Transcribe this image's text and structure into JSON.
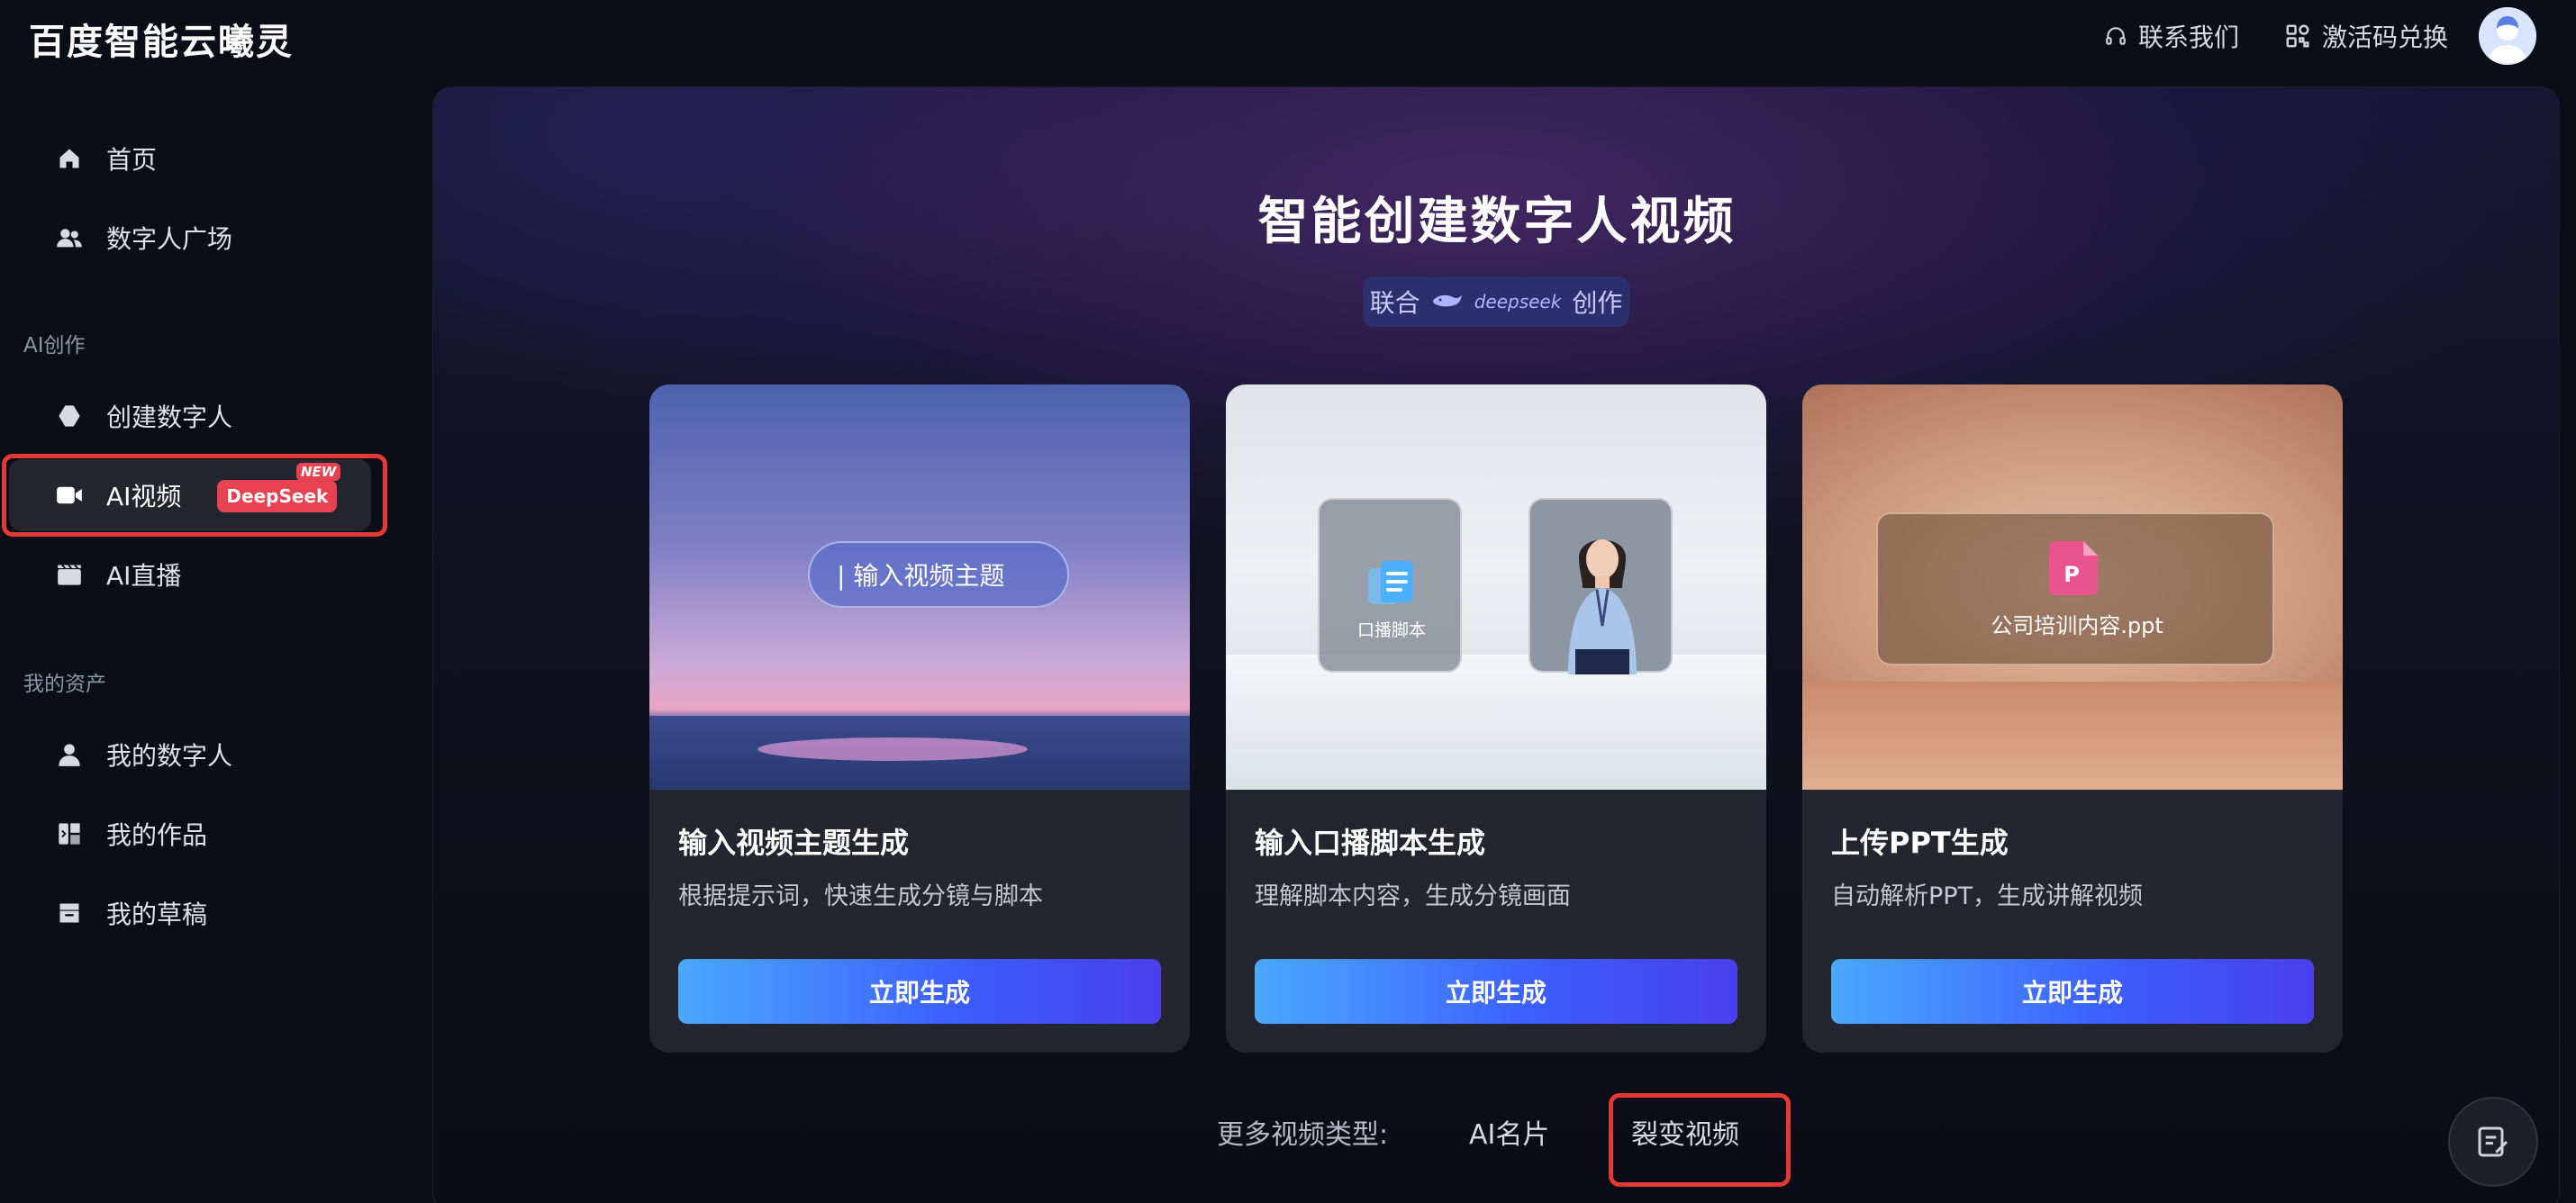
{
  "app": {
    "logo_text": "百度智能云曦灵"
  },
  "header": {
    "contact_label": "联系我们",
    "redeem_label": "激活码兑换",
    "headset_icon": "headset-icon",
    "qr_icon": "qr-grid-icon",
    "avatar_icon": "user-avatar"
  },
  "sidebar": {
    "items_top": [
      {
        "label": "首页",
        "icon": "home-icon"
      },
      {
        "label": "数字人广场",
        "icon": "users-icon"
      }
    ],
    "section_ai": "AI创作",
    "items_ai": [
      {
        "label": "创建数字人",
        "icon": "hexagon-icon"
      },
      {
        "label": "AI视频",
        "icon": "video-camera-icon",
        "badge": "DeepSeek",
        "badge_new": "NEW",
        "active": true
      },
      {
        "label": "AI直播",
        "icon": "clapperboard-icon"
      }
    ],
    "section_assets": "我的资产",
    "items_assets": [
      {
        "label": "我的数字人",
        "icon": "person-icon"
      },
      {
        "label": "我的作品",
        "icon": "works-icon"
      },
      {
        "label": "我的草稿",
        "icon": "drafts-icon"
      }
    ]
  },
  "main": {
    "title": "智能创建数字人视频",
    "coop": {
      "prefix": "联合",
      "brand": "deepseek",
      "suffix": "创作"
    },
    "cards": [
      {
        "title": "输入视频主题生成",
        "desc": "根据提示词，快速生成分镜与脚本",
        "button": "立即生成",
        "image_text": "| 输入视频主题"
      },
      {
        "title": "输入口播脚本生成",
        "desc": "理解脚本内容，生成分镜画面",
        "button": "立即生成",
        "image_text": "口播脚本"
      },
      {
        "title": "上传PPT生成",
        "desc": "自动解析PPT，生成讲解视频",
        "button": "立即生成",
        "image_text": "公司培训内容.ppt",
        "ppt_letter": "P"
      }
    ],
    "more": {
      "label": "更多视频类型:",
      "types": [
        "AI名片",
        "裂变视频"
      ]
    }
  },
  "colors": {
    "accent_start": "#4aa8ff",
    "accent_end": "#4a3ff0",
    "badge": "#e8414f",
    "highlight": "#e53935",
    "background": "#0b0d17"
  }
}
